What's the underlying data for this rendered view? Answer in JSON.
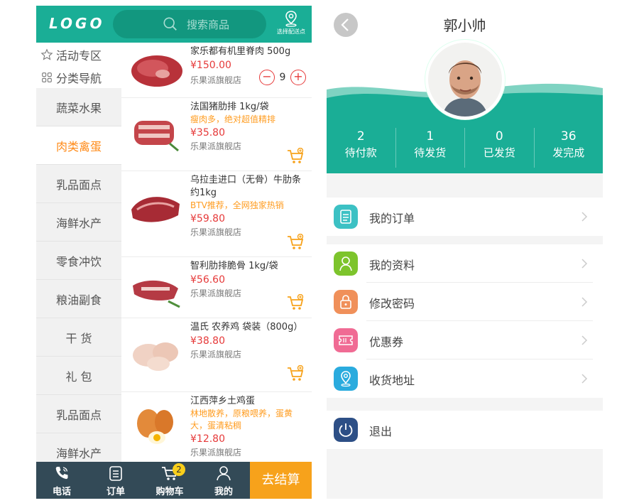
{
  "left": {
    "logo": "LOGO",
    "search_placeholder": "搜索商品",
    "location_label": "选择配送点",
    "sidebar": {
      "special": [
        {
          "label": "活动专区",
          "icon": "star-outline-icon"
        },
        {
          "label": "分类导航",
          "icon": "grid-icon"
        }
      ],
      "categories": [
        "蔬菜水果",
        "肉类禽蛋",
        "乳品面点",
        "海鲜水产",
        "零食冲饮",
        "粮油副食",
        "干 货",
        "礼 包",
        "乳品面点",
        "海鲜水产"
      ],
      "active_index": 1
    },
    "products": [
      {
        "name": "家乐都有机里脊肉 500g",
        "desc": "",
        "price": "¥150.00",
        "shop": "乐果派旗舰店",
        "qty": "9",
        "minus": "−",
        "plus": "+"
      },
      {
        "name": "法国猪肋排 1kg/袋",
        "desc": "瘦肉多，绝对超值精排",
        "price": "¥35.80",
        "shop": "乐果派旗舰店"
      },
      {
        "name": "乌拉圭进口（无骨）牛肋条 约1kg",
        "desc": "BTV推荐，全网独家热销",
        "price": "¥59.80",
        "shop": "乐果派旗舰店"
      },
      {
        "name": "智利肋排脆骨 1kg/袋",
        "desc": "",
        "price": "¥56.60",
        "shop": "乐果派旗舰店"
      },
      {
        "name": "温氏 农养鸡 袋装（800g）",
        "desc": "",
        "price": "¥38.80",
        "shop": "乐果派旗舰店"
      },
      {
        "name": "江西萍乡土鸡蛋",
        "desc": "林地散养，原粮喂养，蛋黄大，蛋清粘稠",
        "price": "¥12.80",
        "shop": "乐果派旗舰店"
      }
    ],
    "bottom": {
      "items": [
        {
          "label": "电话",
          "icon": "phone-icon"
        },
        {
          "label": "订单",
          "icon": "order-list-icon"
        },
        {
          "label": "购物车",
          "icon": "cart-icon",
          "badge": "2"
        },
        {
          "label": "我的",
          "icon": "user-icon"
        }
      ],
      "checkout": "去结算"
    }
  },
  "right": {
    "title": "郭小帅",
    "stats": [
      {
        "count": "2",
        "label": "待付款"
      },
      {
        "count": "1",
        "label": "待发货"
      },
      {
        "count": "0",
        "label": "已发货"
      },
      {
        "count": "36",
        "label": "发完成"
      }
    ],
    "menu": [
      {
        "label": "我的订单",
        "icon": "order-icon",
        "color": "#3cc1c4"
      },
      {
        "label": "我的资料",
        "icon": "profile-icon",
        "color": "#7dc42c"
      },
      {
        "label": "修改密码",
        "icon": "lock-icon",
        "color": "#f0905a"
      },
      {
        "label": "优惠券",
        "icon": "coupon-icon",
        "color": "#f06b94"
      },
      {
        "label": "收货地址",
        "icon": "location-icon",
        "color": "#2aabde"
      },
      {
        "label": "退出",
        "icon": "power-icon",
        "color": "#2d4f86"
      }
    ]
  },
  "colors": {
    "teal": "#1aae96",
    "orange": "#f7a21b",
    "price_red": "#e63a3a",
    "dark_bar": "#334a57"
  }
}
